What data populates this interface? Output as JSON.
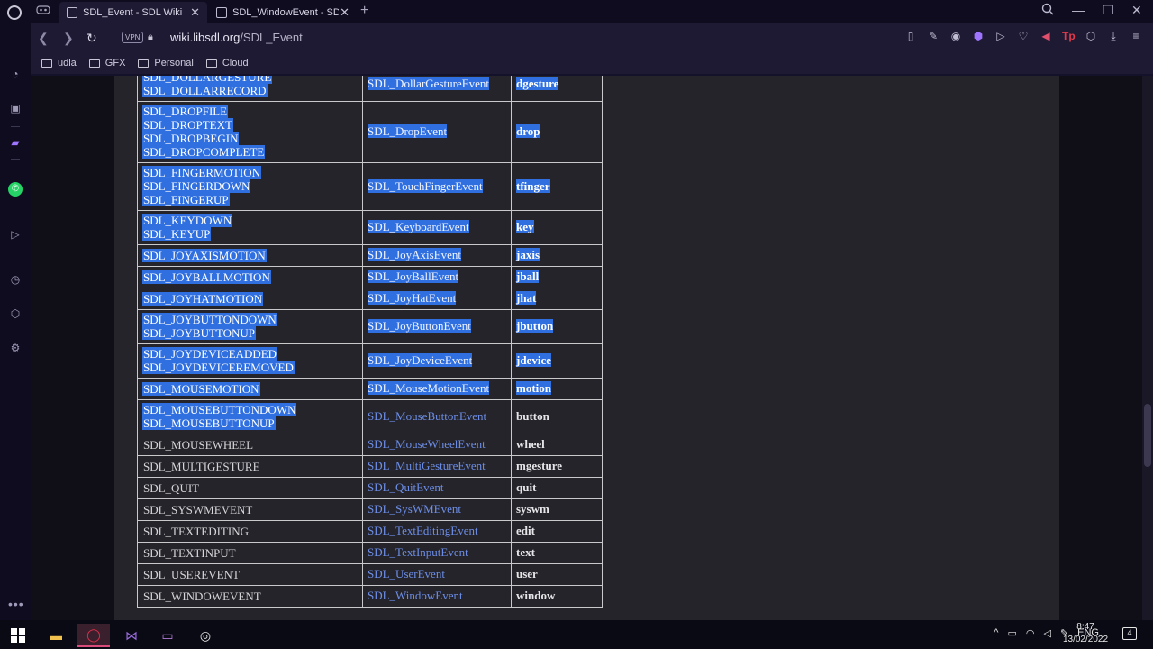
{
  "tabs": [
    {
      "title": "SDL_Event - SDL Wiki",
      "active": true
    },
    {
      "title": "SDL_WindowEvent - SDL W",
      "active": false
    }
  ],
  "address": {
    "domain": "wiki.libsdl.org",
    "path": "/SDL_Event",
    "vpn": "VPN"
  },
  "bookmarks": [
    "udla",
    "GFX",
    "Personal",
    "Cloud"
  ],
  "table_rows": [
    {
      "types": [
        "SDL_DOLLARGESTURE",
        "SDL_DOLLARRECORD"
      ],
      "struct": "SDL_DollarGestureEvent",
      "field": "dgesture",
      "selected": true
    },
    {
      "types": [
        "SDL_DROPFILE",
        "SDL_DROPTEXT",
        "SDL_DROPBEGIN",
        "SDL_DROPCOMPLETE"
      ],
      "struct": "SDL_DropEvent",
      "field": "drop",
      "selected": true
    },
    {
      "types": [
        "SDL_FINGERMOTION",
        "SDL_FINGERDOWN",
        "SDL_FINGERUP"
      ],
      "struct": "SDL_TouchFingerEvent",
      "field": "tfinger",
      "selected": true
    },
    {
      "types": [
        "SDL_KEYDOWN",
        "SDL_KEYUP"
      ],
      "struct": "SDL_KeyboardEvent",
      "field": "key",
      "selected": true
    },
    {
      "types": [
        "SDL_JOYAXISMOTION"
      ],
      "struct": "SDL_JoyAxisEvent",
      "field": "jaxis",
      "selected": true
    },
    {
      "types": [
        "SDL_JOYBALLMOTION"
      ],
      "struct": "SDL_JoyBallEvent",
      "field": "jball",
      "selected": true
    },
    {
      "types": [
        "SDL_JOYHATMOTION"
      ],
      "struct": "SDL_JoyHatEvent",
      "field": "jhat",
      "selected": true
    },
    {
      "types": [
        "SDL_JOYBUTTONDOWN",
        "SDL_JOYBUTTONUP"
      ],
      "struct": "SDL_JoyButtonEvent",
      "field": "jbutton",
      "selected": true
    },
    {
      "types": [
        "SDL_JOYDEVICEADDED",
        "SDL_JOYDEVICEREMOVED"
      ],
      "struct": "SDL_JoyDeviceEvent",
      "field": "jdevice",
      "selected": true
    },
    {
      "types": [
        "SDL_MOUSEMOTION"
      ],
      "struct": "SDL_MouseMotionEvent",
      "field": "motion",
      "selected": true
    },
    {
      "types": [
        "SDL_MOUSEBUTTONDOWN",
        "SDL_MOUSEBUTTONUP"
      ],
      "struct": "SDL_MouseButtonEvent",
      "field": "button",
      "selected": "partial"
    },
    {
      "types": [
        "SDL_MOUSEWHEEL"
      ],
      "struct": "SDL_MouseWheelEvent",
      "field": "wheel",
      "selected": false
    },
    {
      "types": [
        "SDL_MULTIGESTURE"
      ],
      "struct": "SDL_MultiGestureEvent",
      "field": "mgesture",
      "selected": false
    },
    {
      "types": [
        "SDL_QUIT"
      ],
      "struct": "SDL_QuitEvent",
      "field": "quit",
      "selected": false
    },
    {
      "types": [
        "SDL_SYSWMEVENT"
      ],
      "struct": "SDL_SysWMEvent",
      "field": "syswm",
      "selected": false
    },
    {
      "types": [
        "SDL_TEXTEDITING"
      ],
      "struct": "SDL_TextEditingEvent",
      "field": "edit",
      "selected": false
    },
    {
      "types": [
        "SDL_TEXTINPUT"
      ],
      "struct": "SDL_TextInputEvent",
      "field": "text",
      "selected": false
    },
    {
      "types": [
        "SDL_USEREVENT"
      ],
      "struct": "SDL_UserEvent",
      "field": "user",
      "selected": false
    },
    {
      "types": [
        "SDL_WINDOWEVENT"
      ],
      "struct": "SDL_WindowEvent",
      "field": "window",
      "selected": false
    }
  ],
  "taskbar": {
    "language": "ENG",
    "time": "8:47",
    "date": "13/02/2022",
    "notifications": "4"
  }
}
